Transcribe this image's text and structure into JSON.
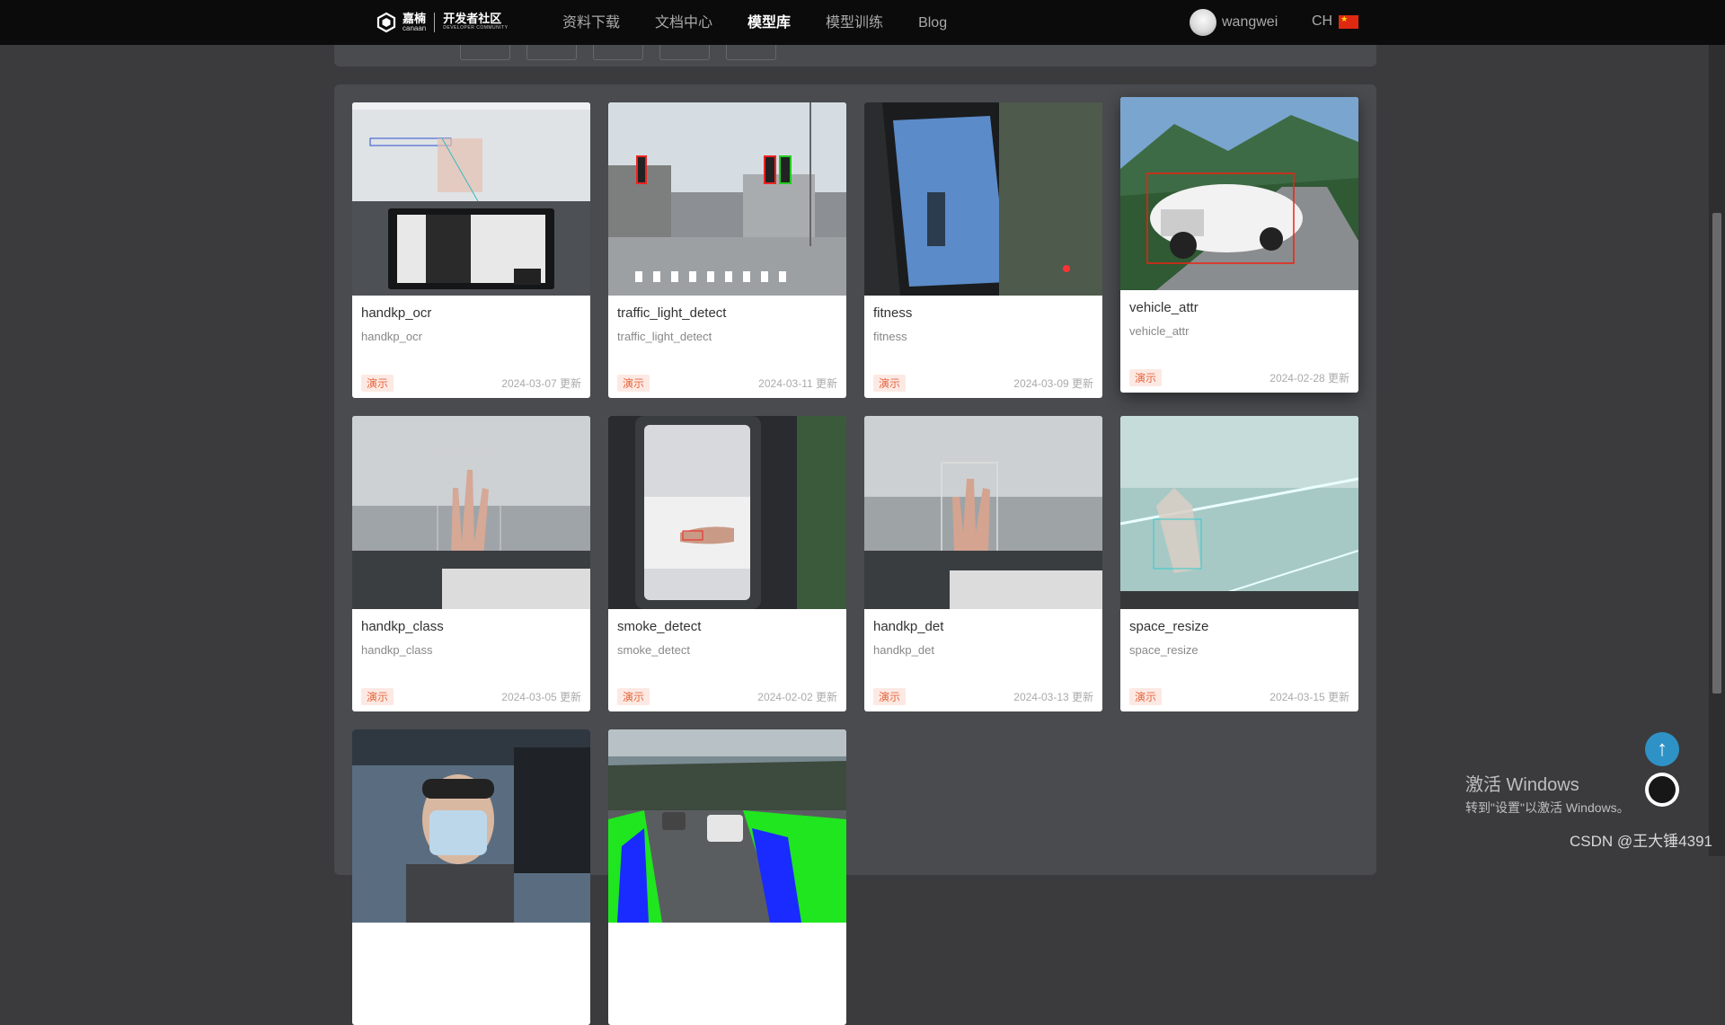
{
  "brand": {
    "name": "嘉楠",
    "name_en": "canaan",
    "community": "开发者社区",
    "community_en": "DEVELOPER COMMUNITY"
  },
  "nav": {
    "items": [
      {
        "label": "资料下载"
      },
      {
        "label": "文档中心"
      },
      {
        "label": "模型库"
      },
      {
        "label": "模型训练"
      },
      {
        "label": "Blog"
      }
    ],
    "active": "模型库"
  },
  "user": {
    "name": "wangwei"
  },
  "lang": {
    "label": "CH"
  },
  "cards": [
    {
      "title": "handkp_ocr",
      "subtitle": "handkp_ocr",
      "tag": "演示",
      "date": "2024-03-07 更新"
    },
    {
      "title": "traffic_light_detect",
      "subtitle": "traffic_light_detect",
      "tag": "演示",
      "date": "2024-03-11 更新"
    },
    {
      "title": "fitness",
      "subtitle": "fitness",
      "tag": "演示",
      "date": "2024-03-09 更新"
    },
    {
      "title": "vehicle_attr",
      "subtitle": "vehicle_attr",
      "tag": "演示",
      "date": "2024-02-28 更新"
    },
    {
      "title": "handkp_class",
      "subtitle": "handkp_class",
      "tag": "演示",
      "date": "2024-03-05 更新"
    },
    {
      "title": "smoke_detect",
      "subtitle": "smoke_detect",
      "tag": "演示",
      "date": "2024-02-02 更新"
    },
    {
      "title": "handkp_det",
      "subtitle": "handkp_det",
      "tag": "演示",
      "date": "2024-03-13 更新"
    },
    {
      "title": "space_resize",
      "subtitle": "space_resize",
      "tag": "演示",
      "date": "2024-03-15 更新"
    }
  ],
  "watermark": {
    "line1": "激活 Windows",
    "line2": "转到\"设置\"以激活 Windows。"
  },
  "csdn": "CSDN @王大锤4391"
}
